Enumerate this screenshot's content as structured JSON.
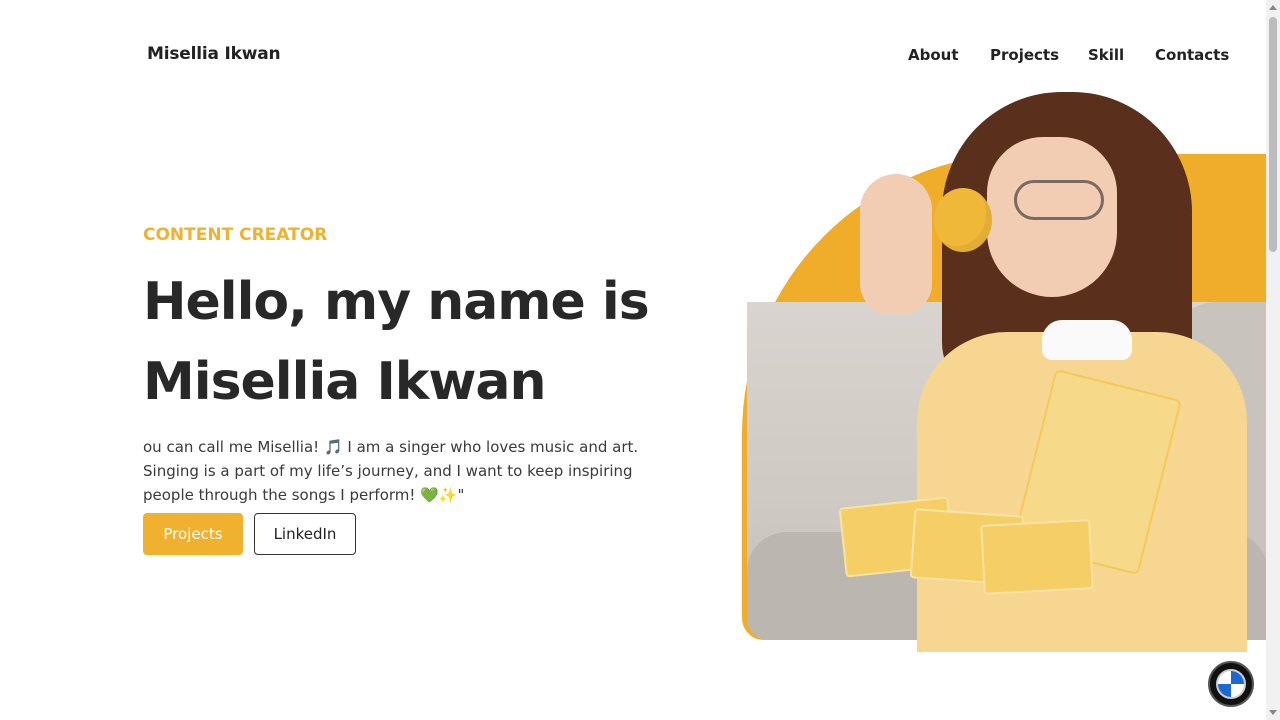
{
  "brand": {
    "name": "Misellia Ikwan"
  },
  "nav": {
    "items": [
      {
        "label": "About"
      },
      {
        "label": "Projects"
      },
      {
        "label": "Skill"
      },
      {
        "label": "Contacts"
      }
    ]
  },
  "hero": {
    "role": "CONTENT CREATOR",
    "headline_line1": "Hello, my name is",
    "headline_line2": "Misellia Ikwan",
    "intro_part1": "ou can call me Misellia! ",
    "intro_emoji1": "🎵",
    "intro_part2": " I am a singer who loves music and art. Singing is a part of my life’s journey, and I want to keep inspiring people through the songs I perform! ",
    "intro_emoji2": "💚",
    "intro_emoji3": "✨",
    "intro_end": "\"",
    "primary_button": "Projects",
    "secondary_button": "LinkedIn"
  },
  "colors": {
    "accent": "#f0b12e",
    "text_dark": "#282828",
    "photo_backdrop": "#f0ad2a"
  },
  "icons": {
    "floating_badge": "bmw-logo-icon"
  }
}
